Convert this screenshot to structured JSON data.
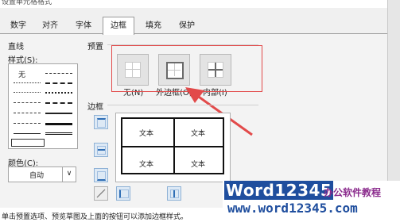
{
  "window": {
    "title": "设置单元格格式"
  },
  "tabs": [
    {
      "label": "数字",
      "active": false
    },
    {
      "label": "对齐",
      "active": false
    },
    {
      "label": "字体",
      "active": false
    },
    {
      "label": "边框",
      "active": true
    },
    {
      "label": "填充",
      "active": false
    },
    {
      "label": "保护",
      "active": false
    }
  ],
  "line": {
    "section": "直线",
    "style_label": "样式(S):",
    "none_label": "无",
    "color_label": "颜色(C):",
    "color_value": "自动"
  },
  "preset": {
    "section": "预置",
    "items": [
      {
        "label": "无(N)"
      },
      {
        "label": "外边框(O)"
      },
      {
        "label": "内部(I)"
      }
    ]
  },
  "border": {
    "section": "边框",
    "cells": [
      "文本",
      "文本",
      "文本",
      "文本"
    ]
  },
  "hint": "单击预置选项、预览草图及上面的按钮可以添加边框样式。",
  "watermark": {
    "brand": "Word12345",
    "tagline": "办公软件教程",
    "url": "www.word12345.com"
  },
  "colors": {
    "highlight_box": "#e24a4a",
    "arrow": "#e24a4a",
    "watermark_blue": "#1f4e9e"
  }
}
